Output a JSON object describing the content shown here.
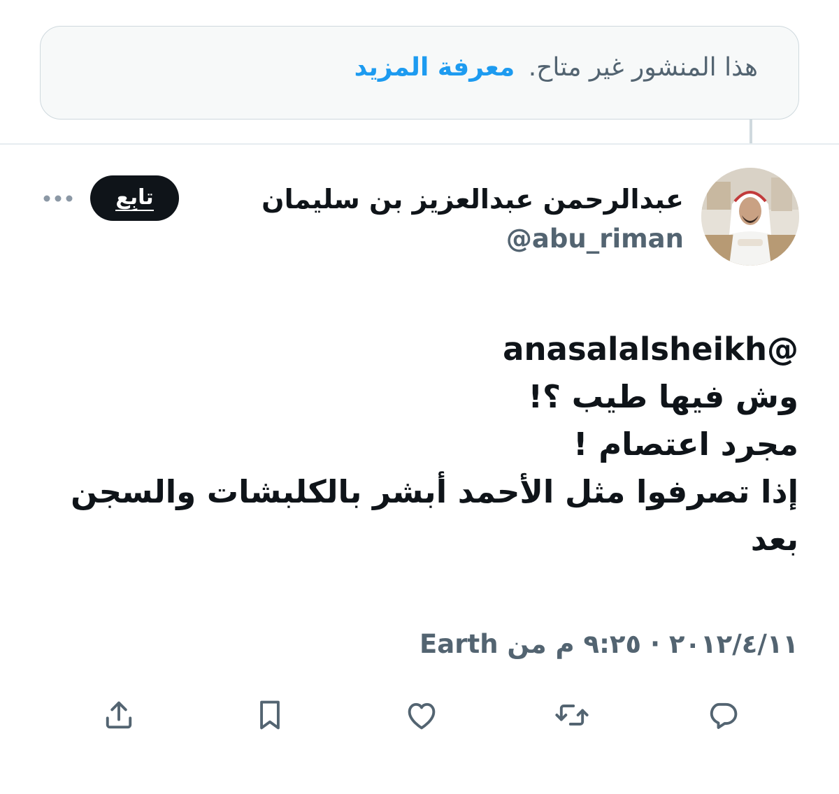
{
  "notice": {
    "text": "هذا المنشور غير متاح.",
    "link_label": "معرفة المزيد"
  },
  "author": {
    "display_name": "عبدالرحمن عبدالعزيز بن سليمان",
    "handle": "@abu_riman",
    "follow_label": "تابِع"
  },
  "tweet": {
    "lines": [
      "anasalalsheikh@",
      "وش فيها طيب ؟!",
      "مجرد اعتصام !",
      "إذا تصرفوا مثل الأحمد أبشر بالكلبشات والسجن",
      "بعد"
    ]
  },
  "meta": {
    "text": "٢٠١٢/٤/١١ · ٩:٢٥ م من Earth"
  },
  "actions": {
    "icons": [
      "reply-icon",
      "retweet-icon",
      "like-icon",
      "bookmark-icon",
      "share-icon"
    ]
  },
  "colors": {
    "accent": "#1d9bf0",
    "secondary_text": "#536471",
    "primary_text": "#0f1419",
    "border": "#cfd9de"
  }
}
